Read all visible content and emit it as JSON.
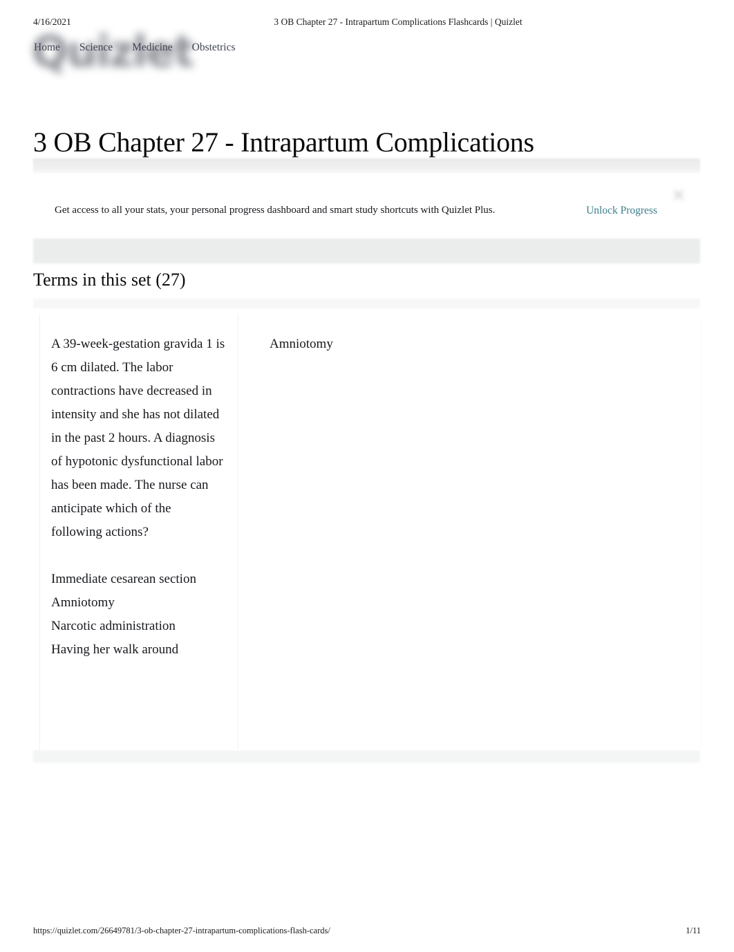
{
  "print": {
    "date": "4/16/2021",
    "header_title": "3 OB Chapter 27 - Intrapartum Complications Flashcards | Quizlet",
    "footer_url": "https://quizlet.com/26649781/3-ob-chapter-27-intrapartum-complications-flash-cards/",
    "page_number": "1/11"
  },
  "brand": {
    "wordmark": "Quizlet"
  },
  "breadcrumb": {
    "separator": "/",
    "items": [
      {
        "label": "Home"
      },
      {
        "label": "Science"
      },
      {
        "label": "Medicine"
      },
      {
        "label": "Obstetrics"
      }
    ]
  },
  "header": {
    "set_title": "3 OB Chapter 27 - Intrapartum Complications"
  },
  "upsell": {
    "message": "Get access to all your stats, your personal progress dashboard and smart study shortcuts with Quizlet Plus.",
    "link_label": "Unlock Progress",
    "link_color": "#3c7e8c",
    "close_icon": "close-icon"
  },
  "terms_section": {
    "heading": "Terms in this set (27)",
    "count": 27,
    "cards": [
      {
        "term": "A 39-week-gestation gravida 1 is 6 cm dilated. The labor contractions have decreased in intensity and she has not dilated in the past 2 hours. A diagnosis of hypotonic dysfunctional labor has been made. The nurse can anticipate which of the following actions?",
        "options": "Immediate cesarean section\nAmniotomy\nNarcotic administration\nHaving her walk around",
        "definition": "Amniotomy"
      }
    ]
  },
  "colors": {
    "page_background": "#ffffff",
    "text": "#16181c",
    "muted_band": "#ebecec",
    "nav_text": "#3f4450"
  }
}
